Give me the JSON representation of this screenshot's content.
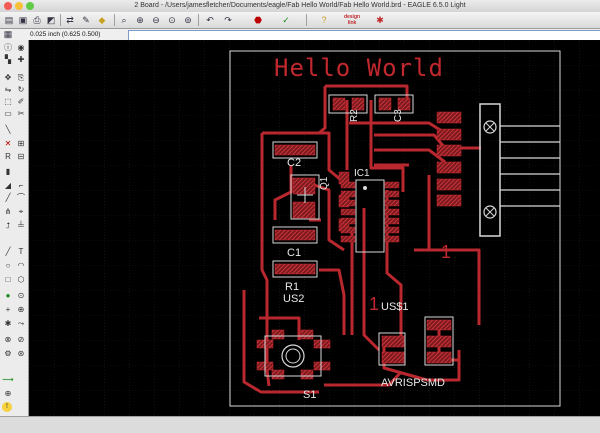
{
  "window": {
    "title": "2 Board - /Users/jamesfletcher/Documents/eagle/Fab Hello World/Fab Hello World.brd - EAGLE 6.5.0 Light"
  },
  "toolbar": {
    "tools": [
      "open-icon",
      "save-icon",
      "print-icon",
      "cam-icon",
      "board-switch-icon",
      "script-icon",
      "run-icon",
      "zoom-fit-icon",
      "zoom-in-icon",
      "zoom-out-icon",
      "zoom-redraw-icon",
      "zoom-select-icon",
      "undo-icon",
      "redo-icon",
      "stop-icon",
      "go-icon",
      "help-icon"
    ],
    "design_link": "design link"
  },
  "command_bar": {
    "coordinates": "0.025 inch (0.625 0.500)",
    "command_value": ""
  },
  "left_toolbar": {
    "tools": [
      "info-icon",
      "show-icon",
      "display-icon",
      "mark-icon",
      "move-icon",
      "copy-icon",
      "mirror-icon",
      "rotate-icon",
      "group-icon",
      "change-icon",
      "paste-icon",
      "delete-icon",
      "add-icon",
      "name-icon",
      "value-icon",
      "smash-icon",
      "miter-icon",
      "split-icon",
      "optimize-icon",
      "route-icon",
      "ripup-icon",
      "wire-icon",
      "text-icon",
      "circle-icon",
      "arc-icon",
      "rect-icon",
      "polygon-icon",
      "via-icon",
      "hole-icon",
      "attribute-icon",
      "dimension-icon",
      "ratsnest-icon",
      "auto-icon",
      "erc-icon",
      "drc-icon",
      "errors-icon"
    ]
  },
  "board": {
    "title_text": "Hello World",
    "colors": {
      "copper": "#b8282e",
      "outline": "#d8d8d8",
      "silk": "#e8e8e8",
      "grid": "#3a3a3a",
      "hatch": "#d02a33"
    },
    "labels": {
      "r2": "R2",
      "c3": "C3",
      "c2": "C2",
      "ic1": "IC1",
      "c1": "C1",
      "r1": "R1",
      "us2": "US2",
      "us1": "US$1",
      "one_a": "1",
      "one_b": "1",
      "s1": "S1",
      "avr": "AVRISPSMD",
      "q1": "Q1"
    }
  }
}
